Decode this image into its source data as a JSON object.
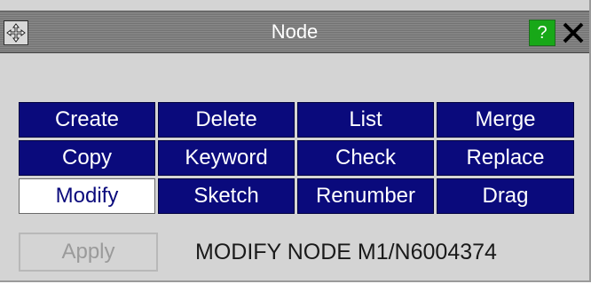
{
  "window": {
    "title": "Node",
    "help_label": "?",
    "move_icon": "move-arrows-icon",
    "close_icon": "close-x-icon"
  },
  "buttons": [
    {
      "label": "Create",
      "active": false
    },
    {
      "label": "Delete",
      "active": false
    },
    {
      "label": "List",
      "active": false
    },
    {
      "label": "Merge",
      "active": false
    },
    {
      "label": "Copy",
      "active": false
    },
    {
      "label": "Keyword",
      "active": false
    },
    {
      "label": "Check",
      "active": false
    },
    {
      "label": "Replace",
      "active": false
    },
    {
      "label": "Modify",
      "active": true
    },
    {
      "label": "Sketch",
      "active": false
    },
    {
      "label": "Renumber",
      "active": false
    },
    {
      "label": "Drag",
      "active": false
    }
  ],
  "footer": {
    "apply_label": "Apply",
    "status_text": "MODIFY NODE M1/N6004374"
  },
  "colors": {
    "button_bg": "#0a0a7c",
    "active_bg": "#ffffff",
    "panel_bg": "#d4d4d4",
    "help_bg": "#18a818"
  }
}
